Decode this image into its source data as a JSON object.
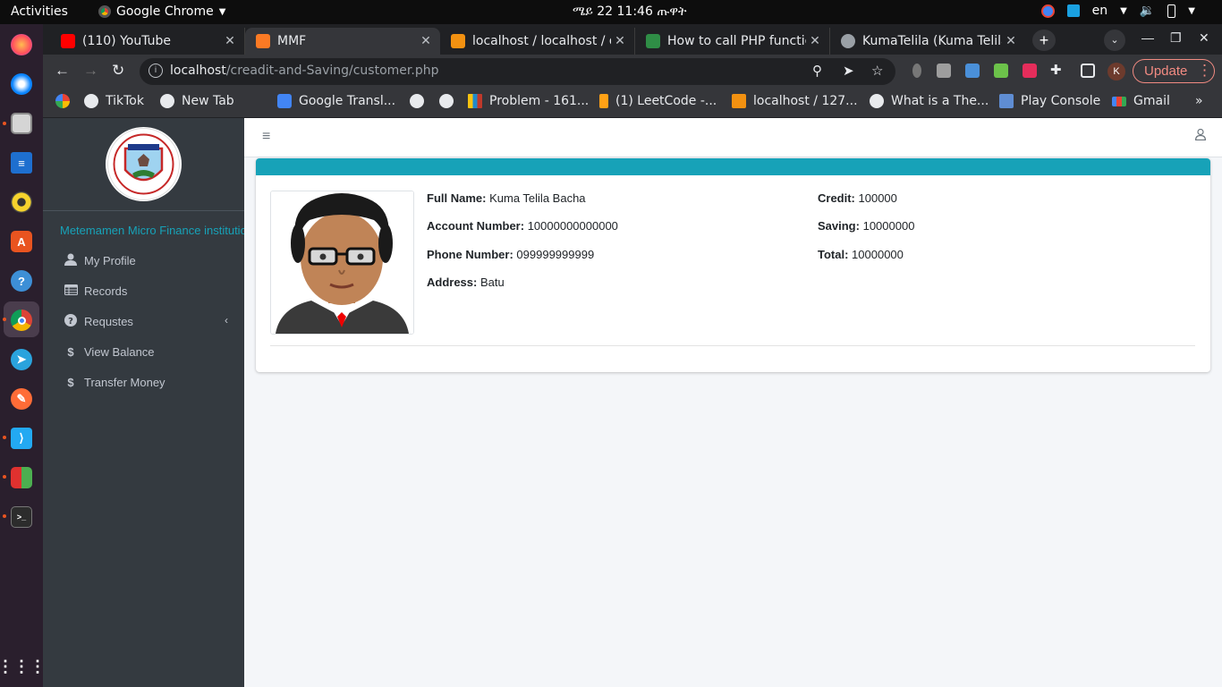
{
  "os": {
    "activities": "Activities",
    "app_name": "Google Chrome",
    "clock": "ሜይ  22  11:46 ጡዋት",
    "lang": "en"
  },
  "tabs": [
    {
      "title": "(110) YouTube",
      "icon_color": "#ff0000"
    },
    {
      "title": "MMF",
      "icon_color": "#fb7a24"
    },
    {
      "title": "localhost / localhost / d",
      "icon_color": "#f29111"
    },
    {
      "title": "How to call PHP functio",
      "icon_color": "#2f8d46"
    },
    {
      "title": "KumaTelila (Kuma Telila",
      "icon_color": "#9aa0a6"
    }
  ],
  "address": {
    "host": "localhost",
    "path": "/creadit-and-Saving/customer.php"
  },
  "browser": {
    "update_label": "Update",
    "profile_initial": "K"
  },
  "bookmarks": [
    {
      "label": "",
      "icon": "google-icon"
    },
    {
      "label": "TikTok",
      "icon": "globe-icon"
    },
    {
      "label": "New Tab",
      "icon": "globe-icon"
    },
    {
      "label": "Google Transl...",
      "icon": "translate-icon"
    },
    {
      "label": "",
      "icon": "globe-icon"
    },
    {
      "label": "",
      "icon": "globe-icon"
    },
    {
      "label": "Problem - 161...",
      "icon": "codeforces-icon"
    },
    {
      "label": "(1) LeetCode -...",
      "icon": "leetcode-icon"
    },
    {
      "label": "localhost / 127...",
      "icon": "phpmyadmin-icon"
    },
    {
      "label": "What is a The...",
      "icon": "wordpress-icon"
    },
    {
      "label": "Play Console",
      "icon": "play-console-icon"
    },
    {
      "label": "Gmail",
      "icon": "gmail-icon"
    }
  ],
  "sidebar": {
    "institution": "Metemamen Micro Finance institution",
    "items": [
      {
        "label": "My Profile",
        "icon": "user-icon"
      },
      {
        "label": "Records",
        "icon": "table-icon"
      },
      {
        "label": "Requstes",
        "icon": "question-icon"
      },
      {
        "label": "View Balance",
        "icon": "dollar-icon"
      },
      {
        "label": "Transfer Money",
        "icon": "dollar-icon"
      }
    ]
  },
  "profile": {
    "full_name_label": "Full Name:",
    "full_name": "Kuma Telila Bacha",
    "account_label": "Account Number:",
    "account": "10000000000000",
    "phone_label": "Phone Number:",
    "phone": "099999999999",
    "address_label": "Address:",
    "address": "Batu",
    "credit_label": "Credit:",
    "credit": "100000",
    "saving_label": "Saving:",
    "saving": "10000000",
    "total_label": "Total:",
    "total": "10000000"
  },
  "colors": {
    "accent": "#17a2b8",
    "sidebar_bg": "#343a40",
    "page_bg": "#f4f6f9"
  }
}
